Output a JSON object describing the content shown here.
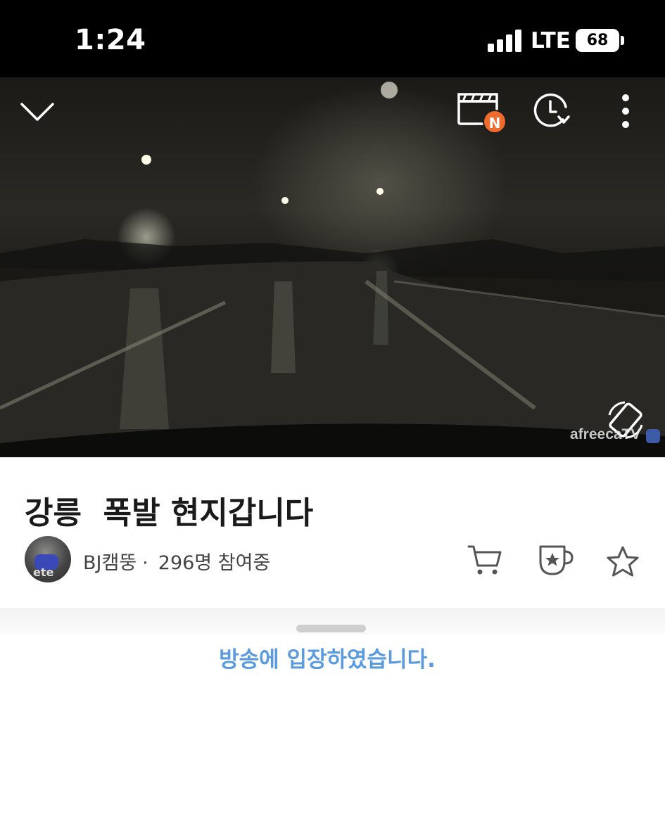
{
  "status_bar": {
    "time": "1:24",
    "network": "LTE",
    "battery": "68"
  },
  "player": {
    "new_badge": "N",
    "watermark": "afreecaTV",
    "icons": [
      "chevron-down-icon",
      "clapperboard-icon",
      "history-icon",
      "more-vertical-icon",
      "rotate-screen-icon"
    ]
  },
  "stream": {
    "title": "강릉  폭발 현지갑니다",
    "avatar_text": "ete",
    "broadcaster": "BJ캠뚱",
    "separator": "·",
    "viewers": "296명 참여중"
  },
  "actions": {
    "icons": [
      "cart-icon",
      "gift-cup-icon",
      "star-icon"
    ]
  },
  "chat": {
    "system_message": "방송에 입장하였습니다."
  },
  "colors": {
    "badge": "#ef6a2d",
    "system_message": "#5a9be0"
  }
}
